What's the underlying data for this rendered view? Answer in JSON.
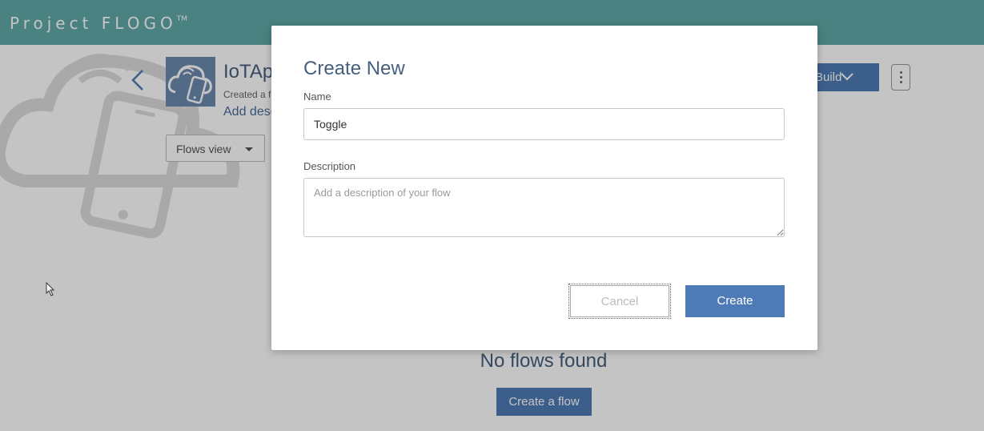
{
  "header": {
    "brand": "Project FLOGO",
    "trademark": "TM"
  },
  "app": {
    "title": "IoTApp",
    "created": "Created a few seconds ago",
    "add_description": "Add description",
    "flows_view_label": "Flows view",
    "build_label": "Build",
    "empty_message": "No flows found",
    "create_flow_label": "Create a flow"
  },
  "modal": {
    "title": "Create New",
    "name_label": "Name",
    "name_value": "Toggle",
    "description_label": "Description",
    "description_placeholder": "Add a description of your flow",
    "cancel_label": "Cancel",
    "create_label": "Create"
  },
  "colors": {
    "header_bg": "#5fa9a7",
    "primary": "#4e7bb5",
    "title_text": "#45607f"
  },
  "icons": {
    "back": "chevron-left-icon",
    "build_dropdown": "chevron-down-icon",
    "more": "vertical-ellipsis-icon",
    "app": "cloud-phone-icon"
  }
}
